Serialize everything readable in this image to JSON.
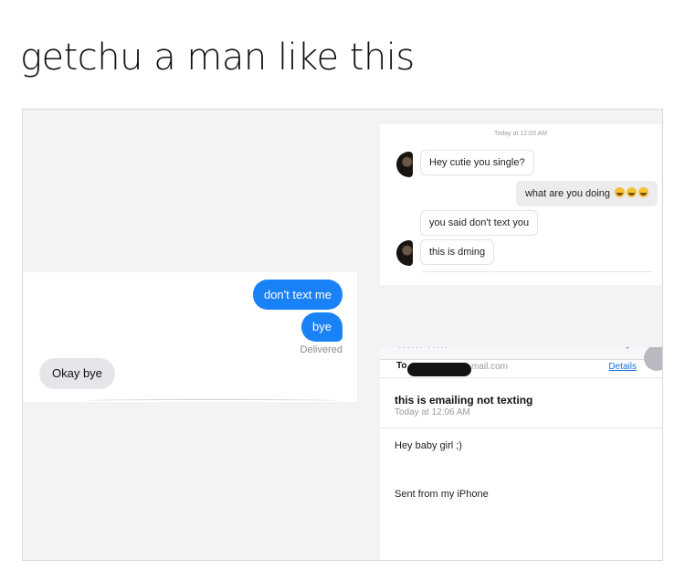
{
  "caption": "getchu a man like this",
  "imessage": {
    "sent_1": "don't text me",
    "sent_2": "bye",
    "status": "Delivered",
    "received_1": "Okay bye"
  },
  "dm": {
    "timestamp": "Today at 12:03 AM",
    "messages": [
      {
        "from": "them",
        "text": "Hey cutie you single?"
      },
      {
        "from": "me",
        "text": "what are you doing",
        "emoji": [
          "laughing-emoji",
          "laughing-emoji",
          "laughing-emoji"
        ]
      },
      {
        "from": "them",
        "text": "you said don't text you"
      },
      {
        "from": "them",
        "text": "this is dming"
      }
    ]
  },
  "mail": {
    "to_label": "To",
    "to_address_visible": "mail.com",
    "details_link": "Details",
    "subject": "this is emailing not texting",
    "date": "Today at 12:06 AM",
    "body_line_1": "Hey baby girl ;)",
    "signature": "Sent from my iPhone"
  },
  "colors": {
    "imessage_blue": "#1a82f7",
    "received_gray": "#e6e6ea",
    "link_blue": "#1a6fd6",
    "redaction": "#121212"
  }
}
